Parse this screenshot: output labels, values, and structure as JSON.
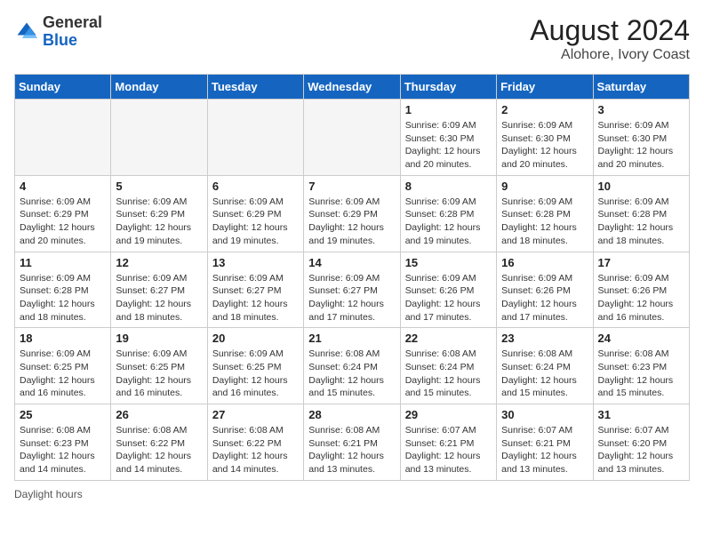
{
  "header": {
    "logo_general": "General",
    "logo_blue": "Blue",
    "month_year": "August 2024",
    "location": "Alohore, Ivory Coast"
  },
  "days_of_week": [
    "Sunday",
    "Monday",
    "Tuesday",
    "Wednesday",
    "Thursday",
    "Friday",
    "Saturday"
  ],
  "legend_label": "Daylight hours",
  "weeks": [
    [
      {
        "day": "",
        "empty": true
      },
      {
        "day": "",
        "empty": true
      },
      {
        "day": "",
        "empty": true
      },
      {
        "day": "",
        "empty": true
      },
      {
        "day": "1",
        "sunrise": "6:09 AM",
        "sunset": "6:30 PM",
        "daylight": "12 hours and 20 minutes."
      },
      {
        "day": "2",
        "sunrise": "6:09 AM",
        "sunset": "6:30 PM",
        "daylight": "12 hours and 20 minutes."
      },
      {
        "day": "3",
        "sunrise": "6:09 AM",
        "sunset": "6:30 PM",
        "daylight": "12 hours and 20 minutes."
      }
    ],
    [
      {
        "day": "4",
        "sunrise": "6:09 AM",
        "sunset": "6:29 PM",
        "daylight": "12 hours and 20 minutes."
      },
      {
        "day": "5",
        "sunrise": "6:09 AM",
        "sunset": "6:29 PM",
        "daylight": "12 hours and 19 minutes."
      },
      {
        "day": "6",
        "sunrise": "6:09 AM",
        "sunset": "6:29 PM",
        "daylight": "12 hours and 19 minutes."
      },
      {
        "day": "7",
        "sunrise": "6:09 AM",
        "sunset": "6:29 PM",
        "daylight": "12 hours and 19 minutes."
      },
      {
        "day": "8",
        "sunrise": "6:09 AM",
        "sunset": "6:28 PM",
        "daylight": "12 hours and 19 minutes."
      },
      {
        "day": "9",
        "sunrise": "6:09 AM",
        "sunset": "6:28 PM",
        "daylight": "12 hours and 18 minutes."
      },
      {
        "day": "10",
        "sunrise": "6:09 AM",
        "sunset": "6:28 PM",
        "daylight": "12 hours and 18 minutes."
      }
    ],
    [
      {
        "day": "11",
        "sunrise": "6:09 AM",
        "sunset": "6:28 PM",
        "daylight": "12 hours and 18 minutes."
      },
      {
        "day": "12",
        "sunrise": "6:09 AM",
        "sunset": "6:27 PM",
        "daylight": "12 hours and 18 minutes."
      },
      {
        "day": "13",
        "sunrise": "6:09 AM",
        "sunset": "6:27 PM",
        "daylight": "12 hours and 18 minutes."
      },
      {
        "day": "14",
        "sunrise": "6:09 AM",
        "sunset": "6:27 PM",
        "daylight": "12 hours and 17 minutes."
      },
      {
        "day": "15",
        "sunrise": "6:09 AM",
        "sunset": "6:26 PM",
        "daylight": "12 hours and 17 minutes."
      },
      {
        "day": "16",
        "sunrise": "6:09 AM",
        "sunset": "6:26 PM",
        "daylight": "12 hours and 17 minutes."
      },
      {
        "day": "17",
        "sunrise": "6:09 AM",
        "sunset": "6:26 PM",
        "daylight": "12 hours and 16 minutes."
      }
    ],
    [
      {
        "day": "18",
        "sunrise": "6:09 AM",
        "sunset": "6:25 PM",
        "daylight": "12 hours and 16 minutes."
      },
      {
        "day": "19",
        "sunrise": "6:09 AM",
        "sunset": "6:25 PM",
        "daylight": "12 hours and 16 minutes."
      },
      {
        "day": "20",
        "sunrise": "6:09 AM",
        "sunset": "6:25 PM",
        "daylight": "12 hours and 16 minutes."
      },
      {
        "day": "21",
        "sunrise": "6:08 AM",
        "sunset": "6:24 PM",
        "daylight": "12 hours and 15 minutes."
      },
      {
        "day": "22",
        "sunrise": "6:08 AM",
        "sunset": "6:24 PM",
        "daylight": "12 hours and 15 minutes."
      },
      {
        "day": "23",
        "sunrise": "6:08 AM",
        "sunset": "6:24 PM",
        "daylight": "12 hours and 15 minutes."
      },
      {
        "day": "24",
        "sunrise": "6:08 AM",
        "sunset": "6:23 PM",
        "daylight": "12 hours and 15 minutes."
      }
    ],
    [
      {
        "day": "25",
        "sunrise": "6:08 AM",
        "sunset": "6:23 PM",
        "daylight": "12 hours and 14 minutes."
      },
      {
        "day": "26",
        "sunrise": "6:08 AM",
        "sunset": "6:22 PM",
        "daylight": "12 hours and 14 minutes."
      },
      {
        "day": "27",
        "sunrise": "6:08 AM",
        "sunset": "6:22 PM",
        "daylight": "12 hours and 14 minutes."
      },
      {
        "day": "28",
        "sunrise": "6:08 AM",
        "sunset": "6:21 PM",
        "daylight": "12 hours and 13 minutes."
      },
      {
        "day": "29",
        "sunrise": "6:07 AM",
        "sunset": "6:21 PM",
        "daylight": "12 hours and 13 minutes."
      },
      {
        "day": "30",
        "sunrise": "6:07 AM",
        "sunset": "6:21 PM",
        "daylight": "12 hours and 13 minutes."
      },
      {
        "day": "31",
        "sunrise": "6:07 AM",
        "sunset": "6:20 PM",
        "daylight": "12 hours and 13 minutes."
      }
    ]
  ]
}
